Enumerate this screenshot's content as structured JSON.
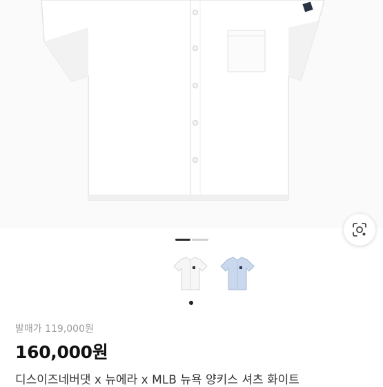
{
  "product": {
    "original_price_label": "발매가 119,000원",
    "price": "160,000원",
    "title": "디스이즈네버댓 x 뉴에라 x MLB 뉴욕 양키스 셔츠 화이트"
  },
  "gallery": {
    "thumbnails": [
      {
        "color": "#f4f4f4",
        "name": "white"
      },
      {
        "color": "#c9d8ec",
        "name": "light-blue"
      }
    ],
    "selected_index": 0
  },
  "icons": {
    "lens": "camera-lens-search-icon"
  }
}
